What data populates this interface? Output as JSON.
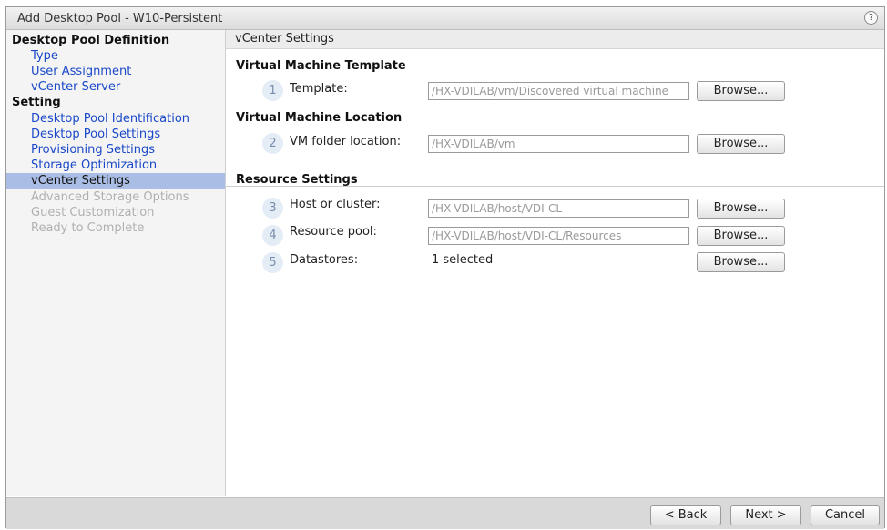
{
  "dialog": {
    "title": "Add Desktop Pool - W10-Persistent",
    "help_icon": "?"
  },
  "sidebar": {
    "items": [
      {
        "label": "Desktop Pool Definition",
        "kind": "section"
      },
      {
        "label": "Type",
        "kind": "link"
      },
      {
        "label": "User Assignment",
        "kind": "link"
      },
      {
        "label": "vCenter Server",
        "kind": "link"
      },
      {
        "label": "Setting",
        "kind": "section"
      },
      {
        "label": "Desktop Pool Identification",
        "kind": "link"
      },
      {
        "label": "Desktop Pool Settings",
        "kind": "link"
      },
      {
        "label": "Provisioning Settings",
        "kind": "link"
      },
      {
        "label": "Storage Optimization",
        "kind": "link"
      },
      {
        "label": "vCenter Settings",
        "kind": "active"
      },
      {
        "label": "Advanced Storage Options",
        "kind": "disabled"
      },
      {
        "label": "Guest Customization",
        "kind": "disabled"
      },
      {
        "label": "Ready to Complete",
        "kind": "disabled"
      }
    ]
  },
  "main": {
    "section_title": "vCenter Settings",
    "groups": {
      "vm_template": "Virtual Machine Template",
      "vm_location": "Virtual Machine Location",
      "resource": "Resource Settings"
    },
    "rows": [
      {
        "num": "1",
        "label": "Template:",
        "value": "/HX-VDILAB/vm/Discovered virtual machine",
        "button": "Browse..."
      },
      {
        "num": "2",
        "label": "VM folder location:",
        "value": "/HX-VDILAB/vm",
        "button": "Browse..."
      },
      {
        "num": "3",
        "label": "Host or cluster:",
        "value": "/HX-VDILAB/host/VDI-CL",
        "button": "Browse..."
      },
      {
        "num": "4",
        "label": "Resource pool:",
        "value": "/HX-VDILAB/host/VDI-CL/Resources",
        "button": "Browse..."
      },
      {
        "num": "5",
        "label": "Datastores:",
        "value": "1 selected",
        "button": "Browse..."
      }
    ]
  },
  "footer": {
    "back": "< Back",
    "next": "Next >",
    "cancel": "Cancel"
  },
  "colors": {
    "link": "#1a48c8",
    "active_bg": "#aabde4",
    "disabled": "#b0b0b0",
    "step_circle": "#e4ecf6"
  }
}
